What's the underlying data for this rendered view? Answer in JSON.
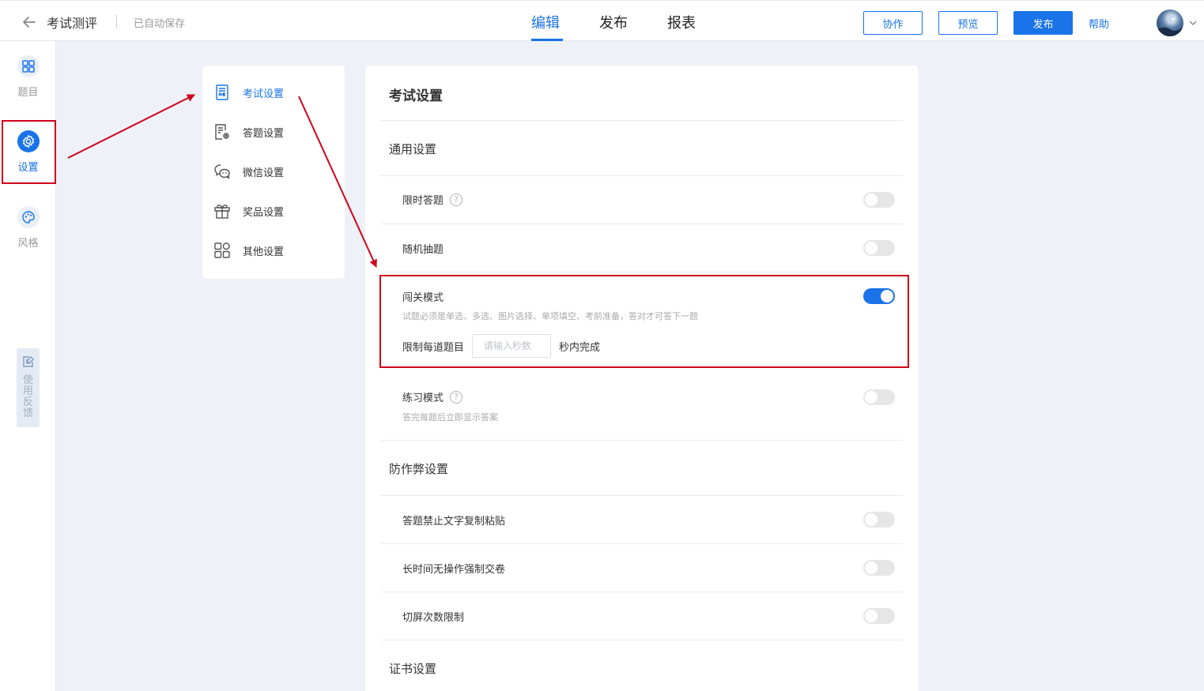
{
  "header": {
    "back_icon": "arrow-left-icon",
    "title": "考试测评",
    "autosave": "已自动保存",
    "tabs": [
      {
        "label": "编辑",
        "active": true
      },
      {
        "label": "发布",
        "active": false
      },
      {
        "label": "报表",
        "active": false
      }
    ],
    "buttons": {
      "collab": "协作",
      "preview": "预览",
      "publish": "发布"
    },
    "help": "帮助",
    "accent_color": "#1a73e8"
  },
  "rail": {
    "items": [
      {
        "label": "题目",
        "icon": "grid-icon",
        "active": false
      },
      {
        "label": "设置",
        "icon": "gear-icon",
        "active": true
      },
      {
        "label": "风格",
        "icon": "palette-icon",
        "active": false
      }
    ],
    "feedback": "使用反馈"
  },
  "submenu": {
    "items": [
      {
        "label": "考试设置",
        "icon": "exam-paper-icon",
        "active": true
      },
      {
        "label": "答题设置",
        "icon": "answer-settings-icon",
        "active": false
      },
      {
        "label": "微信设置",
        "icon": "wechat-icon",
        "active": false
      },
      {
        "label": "奖品设置",
        "icon": "gift-icon",
        "active": false
      },
      {
        "label": "其他设置",
        "icon": "apps-icon",
        "active": false
      }
    ]
  },
  "main": {
    "title": "考试设置",
    "general": {
      "title": "通用设置",
      "rows": [
        {
          "label": "限时答题",
          "help": "?",
          "on": false
        },
        {
          "label": "随机抽题",
          "on": false
        },
        {
          "label": "闯关模式",
          "on": true,
          "desc": "试题必须是单选、多选、图片选择、单项填空、考前准备，答对才可答下一题"
        },
        {
          "label": "练习模式",
          "help": "?",
          "on": false,
          "desc": "答完每题后立即显示答案"
        }
      ],
      "limit": {
        "prefix": "限制每道题目",
        "placeholder": "请输入秒数",
        "suffix": "秒内完成"
      }
    },
    "anticheat": {
      "title": "防作弊设置",
      "rows": [
        {
          "label": "答题禁止文字复制粘贴",
          "on": false
        },
        {
          "label": "长时间无操作强制交卷",
          "on": false
        },
        {
          "label": "切屏次数限制",
          "on": false
        }
      ]
    },
    "certificate": {
      "title": "证书设置"
    }
  },
  "annotation_color": "#d0021b"
}
